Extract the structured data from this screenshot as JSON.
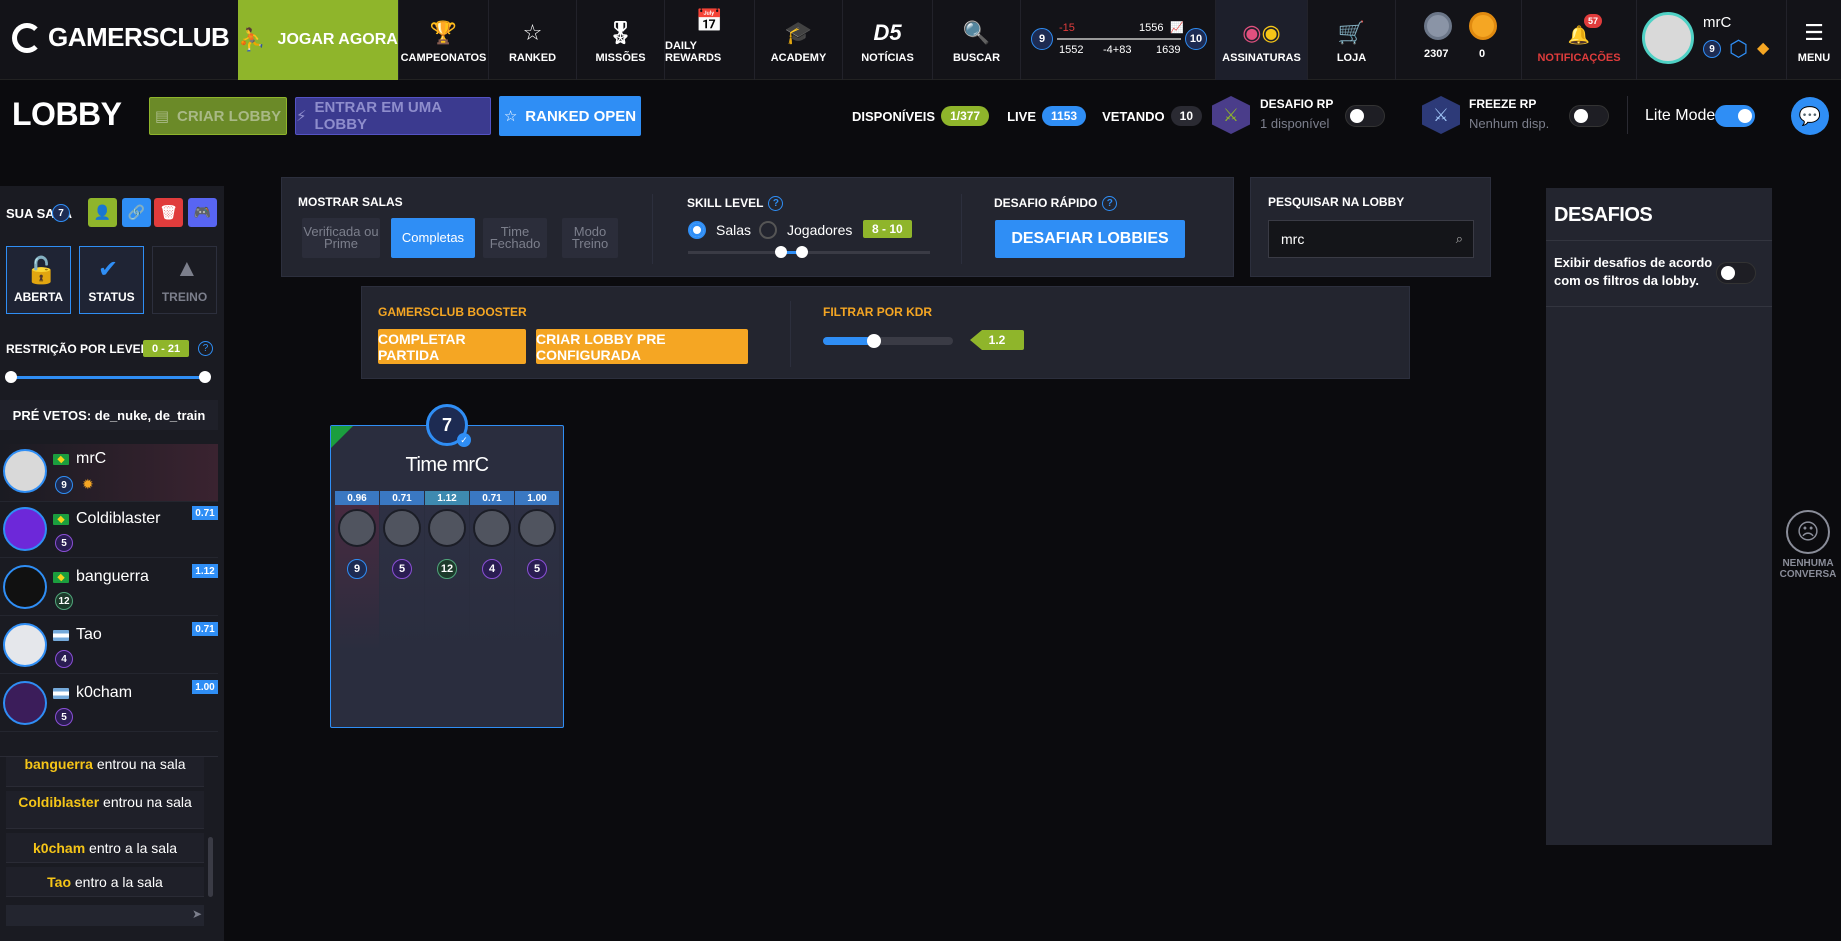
{
  "brand": {
    "logo_text": "GAMERSCLUB"
  },
  "nav": {
    "play_label": "JOGAR AGORA",
    "items": [
      {
        "label": "CAMPEONATOS",
        "icon": "trophy-icon"
      },
      {
        "label": "RANKED",
        "icon": "star-icon"
      },
      {
        "label": "MISSÕES",
        "icon": "medal-icon"
      },
      {
        "label": "DAILY REWARDS",
        "icon": "calendar-icon"
      },
      {
        "label": "ACADEMY",
        "icon": "graduation-cap-icon"
      },
      {
        "label": "NOTÍCIAS",
        "icon": "d5-logo-icon"
      },
      {
        "label": "BUSCAR",
        "icon": "search-icon"
      }
    ],
    "ranking": {
      "level_left": "9",
      "level_right": "10",
      "delta_top": "-15",
      "points_right": "1556",
      "points_left": "1552",
      "delta_mid": "-4+83",
      "points_target": "1639"
    },
    "subs_label": "ASSINATURAS",
    "store_label": "LOJA",
    "coins_silver": "2307",
    "coins_gold": "0",
    "notifications_label": "NOTIFICAÇÕES",
    "notifications_count": "57",
    "user": {
      "name": "mrC",
      "level": "9"
    },
    "menu_label": "MENU"
  },
  "lobby": {
    "title": "LOBBY",
    "create_label": "CRIAR LOBBY",
    "enter_label": "ENTRAR EM UMA LOBBY",
    "ranked_label": "RANKED OPEN",
    "stats": {
      "available_label": "DISPONÍVEIS",
      "available_value": "1/377",
      "live_label": "LIVE",
      "live_value": "1153",
      "vetando_label": "VETANDO",
      "vetando_value": "10"
    },
    "desafio_rp": {
      "title": "DESAFIO RP",
      "sub": "1 disponível",
      "on": false
    },
    "freeze_rp": {
      "title": "FREEZE RP",
      "sub": "Nenhum disp.",
      "on": false
    },
    "lite_mode": {
      "label": "Lite Mode",
      "on": true
    }
  },
  "sidebar": {
    "room_label": "SUA SALA",
    "room_count": "7",
    "modes": [
      {
        "label": "ABERTA",
        "icon": "unlock-icon"
      },
      {
        "label": "STATUS",
        "icon": "verified-badge-icon"
      },
      {
        "label": "TREINO",
        "icon": "cone-icon"
      }
    ],
    "restriction_label": "RESTRIÇÃO POR LEVEL",
    "restriction_value": "0 - 21",
    "prevetos": "PRÉ VETOS: de_nuke, de_train",
    "players": [
      {
        "name": "mrC",
        "level": "9",
        "kdr": "",
        "flag": "br",
        "lvl_color": "#2f8ef5"
      },
      {
        "name": "Coldiblaster",
        "level": "5",
        "kdr": "0.71",
        "flag": "br",
        "lvl_color": "#8a4fd6"
      },
      {
        "name": "banguerra",
        "level": "12",
        "kdr": "1.12",
        "flag": "br",
        "lvl_color": "#4fa57a"
      },
      {
        "name": "Tao",
        "level": "4",
        "kdr": "0.71",
        "flag": "ar",
        "lvl_color": "#8a4fd6"
      },
      {
        "name": "k0cham",
        "level": "5",
        "kdr": "1.00",
        "flag": "ar",
        "lvl_color": "#8a4fd6"
      }
    ],
    "chat": [
      {
        "user": "banguerra",
        "msg": "entrou na sala"
      },
      {
        "user": "Coldiblaster",
        "msg": "entrou na sala"
      },
      {
        "user": "k0cham",
        "msg": "entro a la sala"
      },
      {
        "user": "Tao",
        "msg": "entro a la sala"
      }
    ]
  },
  "filters": {
    "show_rooms_label": "MOSTRAR SALAS",
    "room_filters": [
      "Verificada ou Prime",
      "Completas",
      "Time Fechado",
      "Modo Treino"
    ],
    "skill_label": "SKILL LEVEL",
    "skill_opt1": "Salas",
    "skill_opt2": "Jogadores",
    "skill_range": "8 - 10",
    "quick_label": "DESAFIO RÁPIDO",
    "quick_button": "DESAFIAR LOBBIES",
    "search_label": "PESQUISAR NA LOBBY",
    "search_value": "mrc",
    "booster_label": "GAMERSCLUB BOOSTER",
    "complete_btn": "COMPLETAR PARTIDA",
    "preconf_btn": "CRIAR LOBBY PRE CONFIGURADA",
    "kdr_label": "FILTRAR POR KDR",
    "kdr_value": "1.2"
  },
  "team": {
    "level": "7",
    "name": "Time mrC",
    "slots": [
      {
        "kdr": "0.96",
        "level": "9",
        "color": "#2f8ef5"
      },
      {
        "kdr": "0.71",
        "level": "5",
        "color": "#8a4fd6"
      },
      {
        "kdr": "1.12",
        "level": "12",
        "color": "#4fa57a"
      },
      {
        "kdr": "0.71",
        "level": "4",
        "color": "#8a4fd6"
      },
      {
        "kdr": "1.00",
        "level": "5",
        "color": "#8a4fd6"
      }
    ]
  },
  "desafios": {
    "title": "DESAFIOS",
    "text": "Exibir desafios de acordo com os filtros da lobby.",
    "empty_label": "NENHUMA CONVERSA"
  },
  "colors": {
    "accent": "#2f8ef5",
    "green": "#8fb52b",
    "orange": "#f5a623",
    "purple": "#3b3a8f"
  }
}
